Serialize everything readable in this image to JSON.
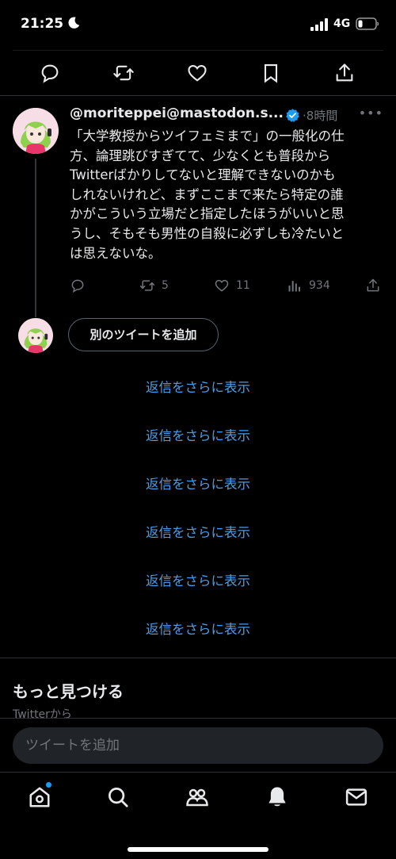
{
  "status_bar": {
    "time": "21:25",
    "network": "4G"
  },
  "tweet_actions": [
    "reply",
    "retweet",
    "like",
    "bookmark",
    "share"
  ],
  "tweet": {
    "handle": "@moriteppei@mastodon.s...",
    "separator": "·",
    "time": "8時間",
    "more": "•••",
    "lines": [
      "「大学教授からツイフェミまで」の一般化の仕",
      "方、論理跳びすぎてて、少なくとも普段から",
      "Twitterばかりしてないと理解できないのかも",
      "しれないけれど、まずここまで来たら特定の誰",
      "かがこういう立場だと指定したほうがいいと思",
      "うし、そもそも男性の自殺に必ずしも冷たいと",
      "は思えないな。"
    ],
    "stats": {
      "reply": "",
      "retweets": "5",
      "likes": "11",
      "views": "934"
    }
  },
  "add_tweet_button": "別のツイートを追加",
  "show_more_replies": [
    "返信をさらに表示",
    "返信をさらに表示",
    "返信をさらに表示",
    "返信をさらに表示",
    "返信をさらに表示",
    "返信をさらに表示"
  ],
  "discover": {
    "title": "もっと見つける",
    "subtitle": "Twitterから"
  },
  "compose": {
    "placeholder": "ツイートを追加"
  },
  "tab_bar": [
    "home",
    "search",
    "communities",
    "notifications",
    "messages"
  ],
  "colors": {
    "background": "#000000",
    "link": "#4a9ee8",
    "verified": "#1d9bf0",
    "muted": "#71767b"
  }
}
